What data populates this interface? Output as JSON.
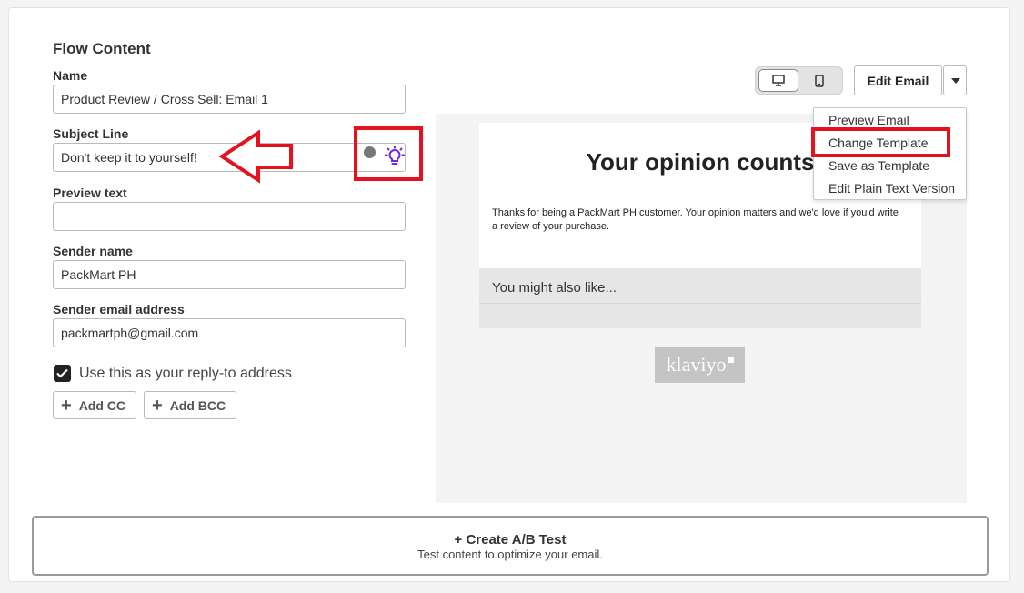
{
  "section_title": "Flow Content",
  "form": {
    "name": {
      "label": "Name",
      "value": "Product Review / Cross Sell: Email 1"
    },
    "subject": {
      "label": "Subject Line",
      "value": "Don't keep it to yourself!"
    },
    "preview_text": {
      "label": "Preview text",
      "value": ""
    },
    "sender_name": {
      "label": "Sender name",
      "value": "PackMart PH"
    },
    "sender_email": {
      "label": "Sender email address",
      "value": "packmartph@gmail.com"
    },
    "reply_to": {
      "label": "Use this as your reply-to address",
      "checked": true
    },
    "add_cc_label": "Add CC",
    "add_bcc_label": "Add BCC"
  },
  "toolbar": {
    "view_modes": [
      "desktop-icon",
      "mobile-icon"
    ],
    "selected_view": "desktop",
    "edit_label": "Edit Email"
  },
  "dropdown": {
    "items": [
      "Preview Email",
      "Change Template",
      "Save as Template",
      "Edit Plain Text Version"
    ]
  },
  "email_preview": {
    "title": "Your opinion counts",
    "body": "Thanks for being a PackMart PH customer. Your opinion matters and we'd love if you'd write a review of your purchase.",
    "also_like": "You might also like...",
    "logo_text": "klaviyo"
  },
  "ab_test": {
    "title": "+ Create A/B Test",
    "subtitle": "Test content to optimize your email."
  },
  "annotation_color": "#e3121e"
}
